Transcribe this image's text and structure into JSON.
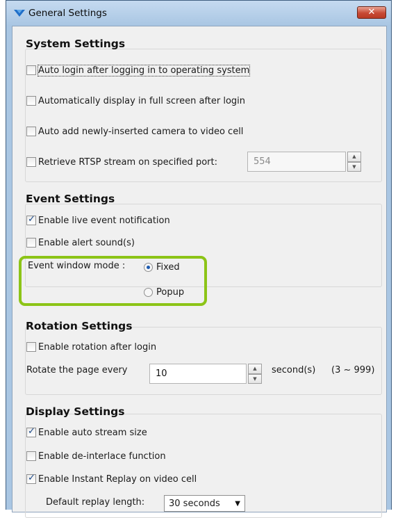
{
  "window": {
    "title": "General Settings",
    "close_label": "✕"
  },
  "system": {
    "title": "System Settings",
    "items": [
      {
        "label": "Auto login after logging in to operating system",
        "checked": false
      },
      {
        "label": "Automatically display in full screen after login",
        "checked": false
      },
      {
        "label": "Auto add newly-inserted camera to video cell",
        "checked": false
      },
      {
        "label": "Retrieve RTSP stream on specified port:",
        "checked": false
      }
    ],
    "rtsp_port": "554"
  },
  "event": {
    "title": "Event Settings",
    "items": [
      {
        "label": "Enable live event notification",
        "checked": true
      },
      {
        "label": "Enable alert sound(s)",
        "checked": false
      }
    ],
    "mode_label": "Event window mode :",
    "mode_options": [
      {
        "label": "Fixed",
        "selected": true
      },
      {
        "label": "Popup",
        "selected": false
      }
    ],
    "highlight_color": "#8cc417"
  },
  "rotation": {
    "title": "Rotation Settings",
    "enable_label": "Enable rotation after login",
    "enable_checked": false,
    "rotate_label": "Rotate the page every",
    "rotate_value": "10",
    "unit_label": "second(s)",
    "range_label": "(3 ~ 999)"
  },
  "display": {
    "title": "Display Settings",
    "items": [
      {
        "label": "Enable auto stream size",
        "checked": true
      },
      {
        "label": "Enable de-interlace function",
        "checked": false
      },
      {
        "label": "Enable Instant Replay on video cell",
        "checked": true
      }
    ],
    "replay_label": "Default replay length:",
    "replay_value": "30 seconds"
  }
}
